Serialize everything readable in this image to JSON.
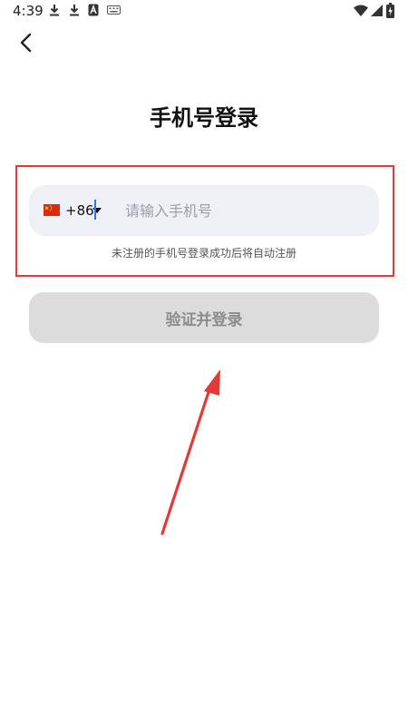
{
  "status_bar": {
    "time": "4:39",
    "icons": [
      "download-icon",
      "download-icon",
      "font-icon",
      "keyboard-icon",
      "wifi-icon",
      "signal-icon",
      "battery-icon"
    ]
  },
  "nav": {
    "back_icon": "chevron-left-icon"
  },
  "login": {
    "title": "手机号登录",
    "country": {
      "flag_icon": "china-flag-icon",
      "code": "+86"
    },
    "phone": {
      "value": "",
      "placeholder": "请输入手机号"
    },
    "hint": "未注册的手机号登录成功后将自动注册",
    "submit_label": "验证并登录"
  },
  "annotation": {
    "color": "#e53935"
  }
}
